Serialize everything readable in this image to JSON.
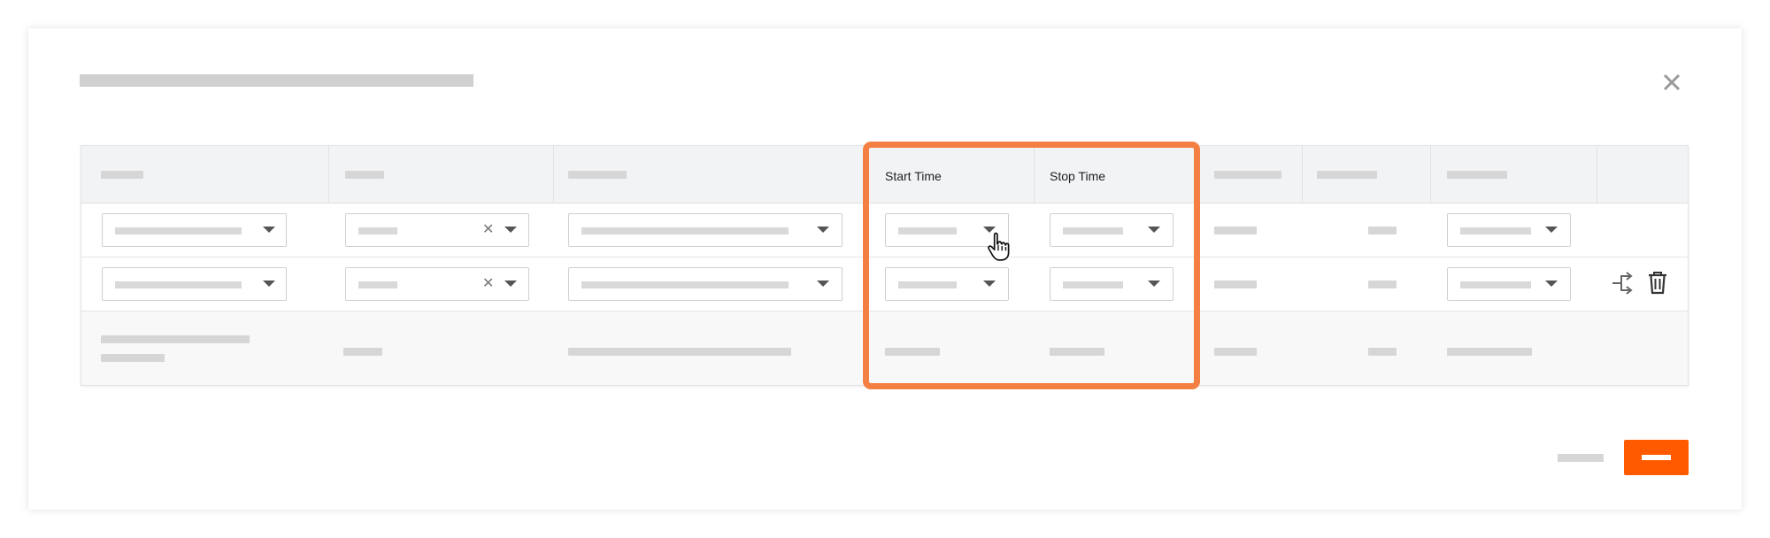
{
  "modal": {
    "close_icon": "close-icon"
  },
  "table": {
    "headers": {
      "start_time": "Start Time",
      "stop_time": "Stop Time"
    },
    "icons": {
      "split": "split-arrow-icon",
      "delete": "trash-icon",
      "cursor": "hand-pointer-icon"
    }
  },
  "colors": {
    "accent": "#ff5a00",
    "highlight": "#f47f42",
    "header_bg": "#f2f3f4",
    "placeholder": "#d6d6d6"
  }
}
